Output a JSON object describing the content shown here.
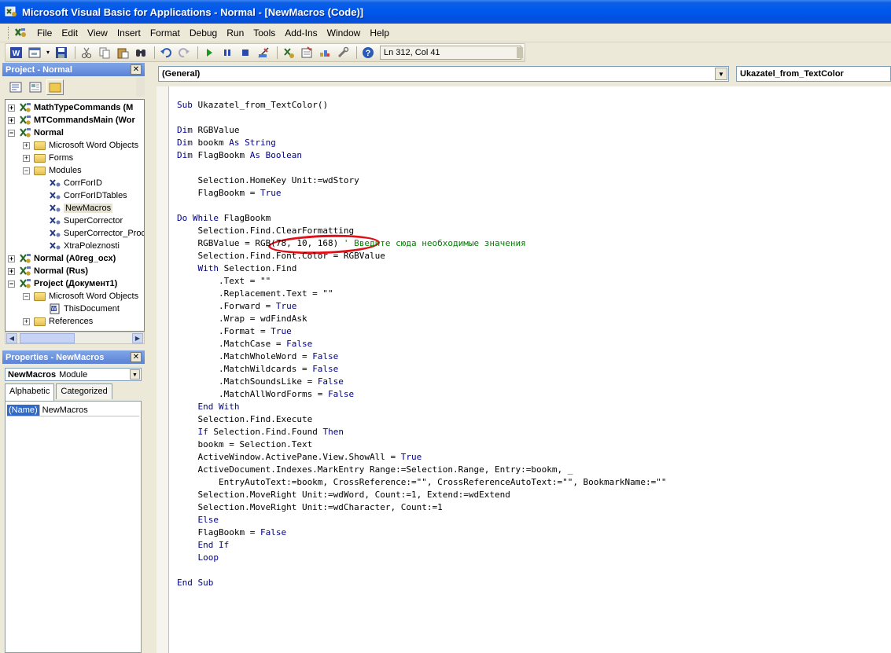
{
  "window": {
    "title": "Microsoft Visual Basic for Applications - Normal - [NewMacros (Code)]"
  },
  "menu": {
    "items": [
      "File",
      "Edit",
      "View",
      "Insert",
      "Format",
      "Debug",
      "Run",
      "Tools",
      "Add-Ins",
      "Window",
      "Help"
    ]
  },
  "toolbar": {
    "position": "Ln 312, Col 41"
  },
  "project": {
    "title": "Project - Normal",
    "tree": [
      {
        "label": "MathTypeCommands (M",
        "bold": true,
        "expander": "+",
        "indent": 0,
        "icon": "project-icon"
      },
      {
        "label": "MTCommandsMain (Wor",
        "bold": true,
        "expander": "+",
        "indent": 0,
        "icon": "project-icon"
      },
      {
        "label": "Normal",
        "bold": true,
        "expander": "-",
        "indent": 0,
        "icon": "project-icon"
      },
      {
        "label": "Microsoft Word Objects",
        "bold": false,
        "expander": "+",
        "indent": 1,
        "icon": "folder-icon"
      },
      {
        "label": "Forms",
        "bold": false,
        "expander": "+",
        "indent": 1,
        "icon": "folder-icon"
      },
      {
        "label": "Modules",
        "bold": false,
        "expander": "-",
        "indent": 1,
        "icon": "folder-icon"
      },
      {
        "label": "CorrForID",
        "bold": false,
        "expander": "",
        "indent": 2,
        "icon": "module-icon"
      },
      {
        "label": "CorrForIDTables",
        "bold": false,
        "expander": "",
        "indent": 2,
        "icon": "module-icon"
      },
      {
        "label": "NewMacros",
        "bold": false,
        "expander": "",
        "indent": 2,
        "icon": "module-icon",
        "selected": true
      },
      {
        "label": "SuperCorrector",
        "bold": false,
        "expander": "",
        "indent": 2,
        "icon": "module-icon"
      },
      {
        "label": "SuperCorrector_Proc",
        "bold": false,
        "expander": "",
        "indent": 2,
        "icon": "module-icon"
      },
      {
        "label": "XtraPoleznosti",
        "bold": false,
        "expander": "",
        "indent": 2,
        "icon": "module-icon"
      },
      {
        "label": "Normal (A0reg_осх)",
        "bold": true,
        "expander": "+",
        "indent": 0,
        "icon": "project-icon"
      },
      {
        "label": "Normal (Rus)",
        "bold": true,
        "expander": "+",
        "indent": 0,
        "icon": "project-icon"
      },
      {
        "label": "Project (Документ1)",
        "bold": true,
        "expander": "-",
        "indent": 0,
        "icon": "project-icon"
      },
      {
        "label": "Microsoft Word Objects",
        "bold": false,
        "expander": "-",
        "indent": 1,
        "icon": "folder-icon"
      },
      {
        "label": "ThisDocument",
        "bold": false,
        "expander": "",
        "indent": 2,
        "icon": "document-icon"
      },
      {
        "label": "References",
        "bold": false,
        "expander": "+",
        "indent": 1,
        "icon": "folder-icon"
      }
    ]
  },
  "properties": {
    "title": "Properties - NewMacros",
    "object_name": "NewMacros",
    "object_type": "Module",
    "tabs": [
      "Alphabetic",
      "Categorized"
    ],
    "rows": [
      {
        "key": "(Name)",
        "value": "NewMacros"
      }
    ]
  },
  "code": {
    "object_combo": "(General)",
    "proc_combo": "Ukazatel_from_TextColor",
    "lines": [
      [],
      [
        [
          "kw",
          "Sub"
        ],
        [
          "t",
          " Ukazatel_from_TextColor()"
        ]
      ],
      [],
      [
        [
          "kw",
          "Dim"
        ],
        [
          "t",
          " RGBValue"
        ]
      ],
      [
        [
          "kw",
          "Dim"
        ],
        [
          "t",
          " bookm "
        ],
        [
          "kw",
          "As String"
        ]
      ],
      [
        [
          "kw",
          "Dim"
        ],
        [
          "t",
          " FlagBookm "
        ],
        [
          "kw",
          "As Boolean"
        ]
      ],
      [],
      [
        [
          "t",
          "    Selection.HomeKey Unit:=wdStory"
        ]
      ],
      [
        [
          "t",
          "    FlagBookm = "
        ],
        [
          "kw",
          "True"
        ]
      ],
      [],
      [
        [
          "kw",
          "Do While"
        ],
        [
          "t",
          " FlagBookm"
        ]
      ],
      [
        [
          "t",
          "    Selection.Find.ClearFormatting"
        ]
      ],
      [
        [
          "t",
          "    RGBValue = RGB(78, 10, 168) "
        ],
        [
          "cm",
          "' Введите сюда необходимые значения"
        ]
      ],
      [
        [
          "t",
          "    Selection.Find.Font.Color = RGBValue"
        ]
      ],
      [
        [
          "t",
          "    "
        ],
        [
          "kw",
          "With"
        ],
        [
          "t",
          " Selection.Find"
        ]
      ],
      [
        [
          "t",
          "        .Text = \"\""
        ]
      ],
      [
        [
          "t",
          "        .Replacement.Text = \"\""
        ]
      ],
      [
        [
          "t",
          "        .Forward = "
        ],
        [
          "kw",
          "True"
        ]
      ],
      [
        [
          "t",
          "        .Wrap = wdFindAsk"
        ]
      ],
      [
        [
          "t",
          "        .Format = "
        ],
        [
          "kw",
          "True"
        ]
      ],
      [
        [
          "t",
          "        .MatchCase = "
        ],
        [
          "kw",
          "False"
        ]
      ],
      [
        [
          "t",
          "        .MatchWholeWord = "
        ],
        [
          "kw",
          "False"
        ]
      ],
      [
        [
          "t",
          "        .MatchWildcards = "
        ],
        [
          "kw",
          "False"
        ]
      ],
      [
        [
          "t",
          "        .MatchSoundsLike = "
        ],
        [
          "kw",
          "False"
        ]
      ],
      [
        [
          "t",
          "        .MatchAllWordForms = "
        ],
        [
          "kw",
          "False"
        ]
      ],
      [
        [
          "t",
          "    "
        ],
        [
          "kw",
          "End With"
        ]
      ],
      [
        [
          "t",
          "    Selection.Find.Execute"
        ]
      ],
      [
        [
          "t",
          "    "
        ],
        [
          "kw",
          "If"
        ],
        [
          "t",
          " Selection.Find.Found "
        ],
        [
          "kw",
          "Then"
        ]
      ],
      [
        [
          "t",
          "    bookm = Selection.Text"
        ]
      ],
      [
        [
          "t",
          "    ActiveWindow.ActivePane.View.ShowAll = "
        ],
        [
          "kw",
          "True"
        ]
      ],
      [
        [
          "t",
          "    ActiveDocument.Indexes.MarkEntry Range:=Selection.Range, Entry:=bookm, _"
        ]
      ],
      [
        [
          "t",
          "        EntryAutoText:=bookm, CrossReference:=\"\", CrossReferenceAutoText:=\"\", BookmarkName:=\"\""
        ]
      ],
      [
        [
          "t",
          "    Selection.MoveRight Unit:=wdWord, Count:=1, Extend:=wdExtend"
        ]
      ],
      [
        [
          "t",
          "    Selection.MoveRight Unit:=wdCharacter, Count:=1"
        ]
      ],
      [
        [
          "t",
          "    "
        ],
        [
          "kw",
          "Else"
        ]
      ],
      [
        [
          "t",
          "    FlagBookm = "
        ],
        [
          "kw",
          "False"
        ]
      ],
      [
        [
          "t",
          "    "
        ],
        [
          "kw",
          "End If"
        ]
      ],
      [
        [
          "t",
          "    "
        ],
        [
          "kw",
          "Loop"
        ]
      ],
      [],
      [
        [
          "kw",
          "End Sub"
        ]
      ]
    ]
  }
}
